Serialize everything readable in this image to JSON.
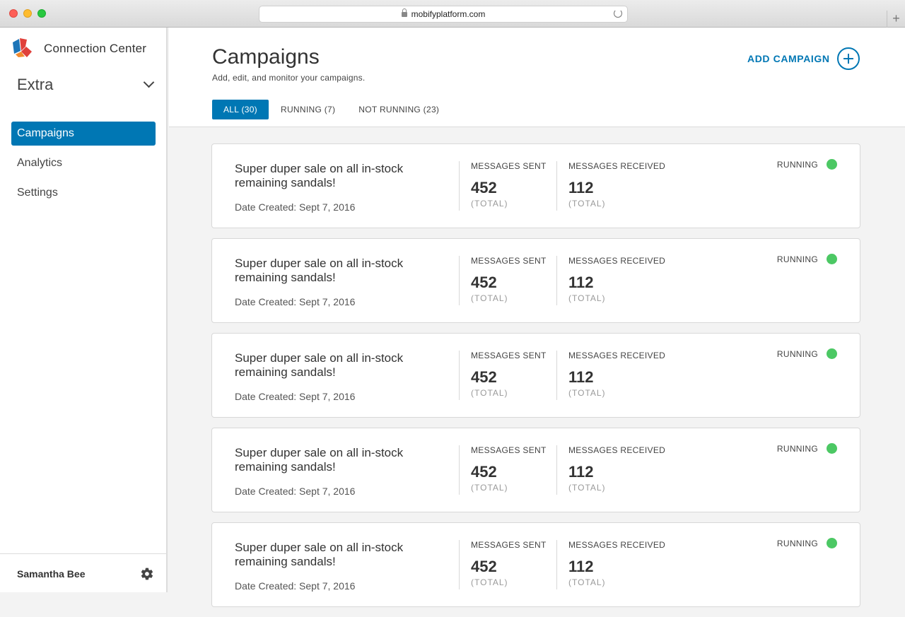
{
  "browser": {
    "url": "mobifyplatform.com",
    "new_tab": "+"
  },
  "sidebar": {
    "brand": "Connection Center",
    "org": "Extra",
    "nav": [
      {
        "label": "Campaigns",
        "active": true
      },
      {
        "label": "Analytics",
        "active": false
      },
      {
        "label": "Settings",
        "active": false
      }
    ],
    "user": "Samantha Bee"
  },
  "header": {
    "title": "Campaigns",
    "subtitle": "Add, edit, and monitor your campaigns.",
    "add_label": "ADD CAMPAIGN",
    "tabs": [
      {
        "label": "ALL (30)",
        "active": true
      },
      {
        "label": "RUNNING (7)",
        "active": false
      },
      {
        "label": "NOT RUNNING (23)",
        "active": false
      }
    ]
  },
  "campaigns": [
    {
      "title": "Super duper sale on all in-stock remaining sandals!",
      "date": "Date Created: Sept 7, 2016",
      "sent_label": "MESSAGES SENT",
      "sent": "452",
      "sent_unit": "(TOTAL)",
      "received_label": "MESSAGES RECEIVED",
      "received": "112",
      "received_unit": "(TOTAL)",
      "status": "RUNNING"
    },
    {
      "title": "Super duper sale on all in-stock remaining sandals!",
      "date": "Date Created: Sept 7, 2016",
      "sent_label": "MESSAGES SENT",
      "sent": "452",
      "sent_unit": "(TOTAL)",
      "received_label": "MESSAGES RECEIVED",
      "received": "112",
      "received_unit": "(TOTAL)",
      "status": "RUNNING"
    },
    {
      "title": "Super duper sale on all in-stock remaining sandals!",
      "date": "Date Created: Sept 7, 2016",
      "sent_label": "MESSAGES SENT",
      "sent": "452",
      "sent_unit": "(TOTAL)",
      "received_label": "MESSAGES RECEIVED",
      "received": "112",
      "received_unit": "(TOTAL)",
      "status": "RUNNING"
    },
    {
      "title": "Super duper sale on all in-stock remaining sandals!",
      "date": "Date Created: Sept 7, 2016",
      "sent_label": "MESSAGES SENT",
      "sent": "452",
      "sent_unit": "(TOTAL)",
      "received_label": "MESSAGES RECEIVED",
      "received": "112",
      "received_unit": "(TOTAL)",
      "status": "RUNNING"
    },
    {
      "title": "Super duper sale on all in-stock remaining sandals!",
      "date": "Date Created: Sept 7, 2016",
      "sent_label": "MESSAGES SENT",
      "sent": "452",
      "sent_unit": "(TOTAL)",
      "received_label": "MESSAGES RECEIVED",
      "received": "112",
      "received_unit": "(TOTAL)",
      "status": "RUNNING"
    }
  ],
  "colors": {
    "accent": "#0077b4",
    "status_running": "#4cc864",
    "logo_blue": "#1d75b8",
    "logo_red": "#e0403a",
    "logo_orange": "#f28a2e"
  },
  "icons": {
    "add": "plus-circle-icon",
    "settings": "gear-icon",
    "org_dropdown": "chevron-down-icon",
    "secure": "lock-icon",
    "reload": "reload-icon"
  }
}
